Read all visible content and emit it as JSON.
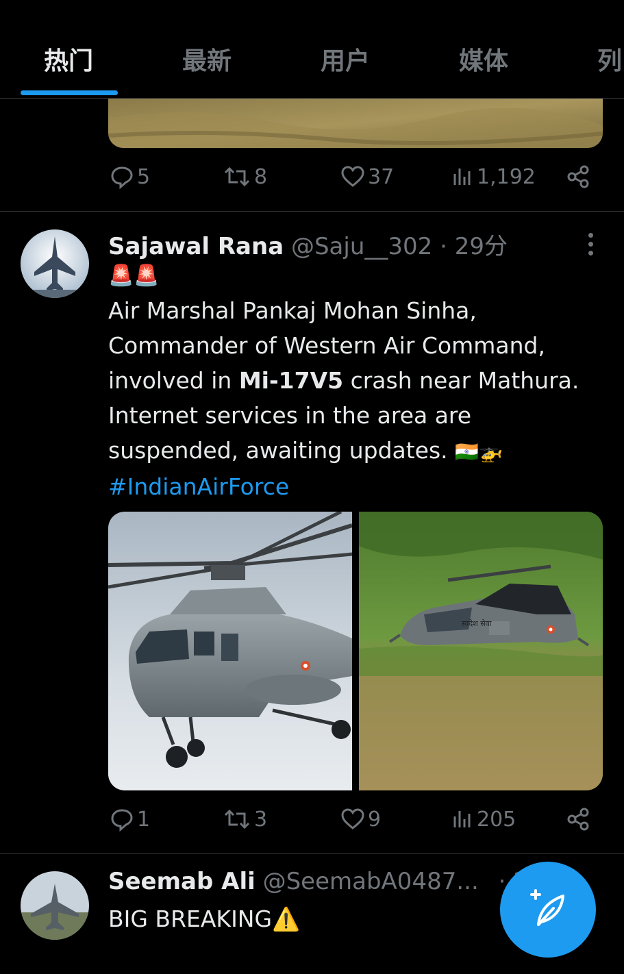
{
  "tabs": [
    {
      "label": "热门",
      "active": true
    },
    {
      "label": "最新",
      "active": false
    },
    {
      "label": "用户",
      "active": false
    },
    {
      "label": "媒体",
      "active": false
    },
    {
      "label": "列",
      "active": false
    }
  ],
  "prev_post": {
    "actions": {
      "replies": "5",
      "reposts": "8",
      "likes": "37",
      "views": "1,192"
    }
  },
  "post1": {
    "name": "Sajawal Rana",
    "handle": "@Saju__302",
    "separator": "·",
    "time": "29分",
    "alert_emojis": "🚨🚨",
    "text_line1": "Air Marshal Pankaj Mohan Sinha,",
    "text_line2": "Commander of Western Air Command,",
    "text_line3_pre": "involved in ",
    "text_line3_bold": "Mi-17V5",
    "text_line3_post": " crash near Mathura.",
    "text_line4": "Internet services in the area are",
    "text_line5": "suspended, awaiting updates. ",
    "text_emojis": "🇮🇳🚁",
    "hashtag": "#IndianAirForce",
    "image_caption": "स्वदेश सेवा",
    "actions": {
      "replies": "1",
      "reposts": "3",
      "likes": "9",
      "views": "205"
    }
  },
  "post2": {
    "name": "Seemab Ali",
    "handle": "@SeemabA0487...",
    "separator": "·",
    "time": "2",
    "text": "BIG BREAKING",
    "text_emoji": "⚠️"
  },
  "colors": {
    "accent": "#1d9bf0",
    "muted": "#71767b",
    "text": "#e7e9ea",
    "background": "#000000",
    "divider": "#2f3336"
  },
  "icons": [
    "reply-icon",
    "repost-icon",
    "like-icon",
    "views-icon",
    "share-icon",
    "more-icon",
    "compose-icon"
  ]
}
